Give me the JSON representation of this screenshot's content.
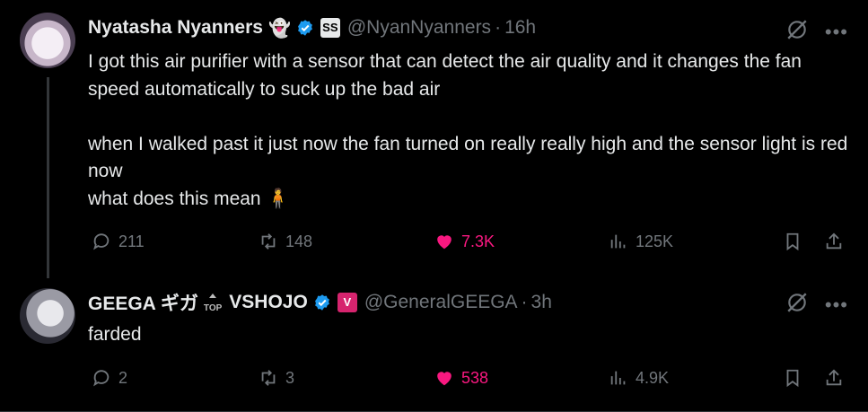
{
  "tweets": [
    {
      "author_name": "Nyatasha Nyanners",
      "name_emoji": "👻",
      "affiliate_badge": "SS",
      "handle": "@NyanNyanners",
      "separator": "·",
      "time": "16h",
      "text": "I got this air purifier with a sensor that can detect the air quality and it changes the fan speed automatically to suck up the bad air\n\nwhen I walked past it just now the fan turned on really really high and the sensor light is red now\nwhat does this mean 🧍",
      "replies": "211",
      "reposts": "148",
      "likes": "7.3K",
      "views": "125K"
    },
    {
      "author_name": "GEEGA ギガ",
      "name_suffix_badge": "TOP",
      "author_name_2": "VSHOJO",
      "affiliate_badge": "V",
      "handle": "@GeneralGEEGA",
      "separator": "·",
      "time": "3h",
      "text": "farded",
      "replies": "2",
      "reposts": "3",
      "likes": "538",
      "views": "4.9K"
    }
  ],
  "colors": {
    "background": "#000000",
    "text": "#e7e9ea",
    "muted": "#71767b",
    "like_pink": "#f91880",
    "verified_blue": "#1d9bf0",
    "vshojo_badge": "#d6246e"
  },
  "icons": [
    "grok-icon",
    "more-icon",
    "reply-icon",
    "repost-icon",
    "like-icon",
    "views-icon",
    "bookmark-icon",
    "share-icon",
    "verified-icon"
  ]
}
